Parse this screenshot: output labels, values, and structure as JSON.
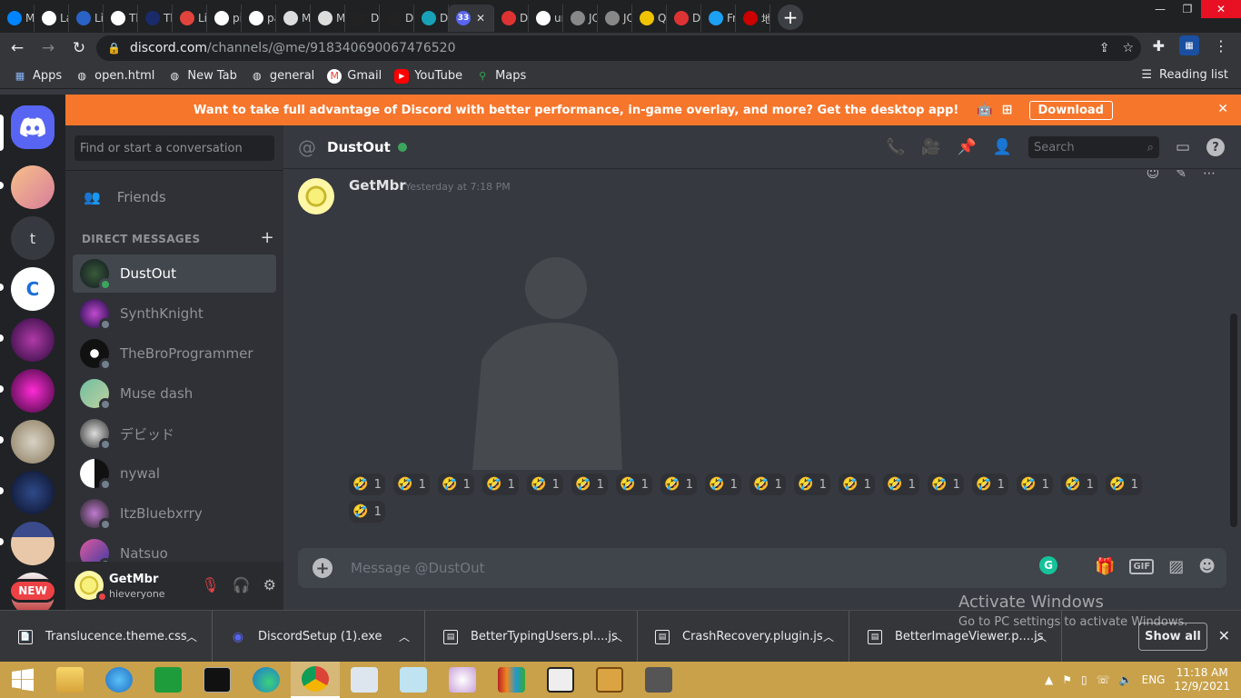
{
  "browser": {
    "tabs": [
      {
        "label": "Me",
        "color": "#0084ff"
      },
      {
        "label": "La",
        "color": "#ffffff"
      },
      {
        "label": "Lig",
        "color": "#2a62c6"
      },
      {
        "label": "Th",
        "color": "#ffffff"
      },
      {
        "label": "Th",
        "color": "#1a2b6b"
      },
      {
        "label": "Lig",
        "color": "#e0443c"
      },
      {
        "label": "pi",
        "color": "#ffffff"
      },
      {
        "label": "pa",
        "color": "#ffffff"
      },
      {
        "label": "M",
        "color": "#dddddd"
      },
      {
        "label": "M",
        "color": "#dddddd"
      },
      {
        "label": "DC",
        "color": "#222222"
      },
      {
        "label": "DC",
        "color": "#222222"
      },
      {
        "label": "Dc",
        "color": "#17a2b8"
      },
      {
        "label": "33",
        "color": "#5865f2",
        "active": true
      },
      {
        "label": "Di",
        "color": "#d33"
      },
      {
        "label": "un",
        "color": "#ffffff"
      },
      {
        "label": "JQ",
        "color": "#888888"
      },
      {
        "label": "JQ",
        "color": "#888888"
      },
      {
        "label": "Qu",
        "color": "#f0c300"
      },
      {
        "label": "Di",
        "color": "#d33"
      },
      {
        "label": "Fr",
        "color": "#1da1f2"
      },
      {
        "label": "地",
        "color": "#cc0000"
      }
    ],
    "url_host": "discord.com",
    "url_path": "/channels/@me/918340690067476520",
    "bookmarks": [
      {
        "label": "Apps",
        "icon": "apps-grid-icon"
      },
      {
        "label": "open.html",
        "icon": "globe-icon"
      },
      {
        "label": "New Tab",
        "icon": "globe-icon"
      },
      {
        "label": "general",
        "icon": "globe-icon"
      },
      {
        "label": "Gmail",
        "icon": "gmail-icon"
      },
      {
        "label": "YouTube",
        "icon": "youtube-icon"
      },
      {
        "label": "Maps",
        "icon": "maps-icon"
      }
    ],
    "reading_list": "Reading list"
  },
  "banner": {
    "text": "Want to take full advantage of Discord with better performance, in-game overlay, and more? Get the desktop app!",
    "download": "Download"
  },
  "guilds": {
    "new_badge": "NEW",
    "text_server": "t"
  },
  "dm": {
    "search_placeholder": "Find or start a conversation",
    "friends": "Friends",
    "header": "DIRECT MESSAGES",
    "items": [
      {
        "name": "DustOut",
        "active": true
      },
      {
        "name": "SynthKnight"
      },
      {
        "name": "TheBroProgrammer"
      },
      {
        "name": "Muse dash"
      },
      {
        "name": "デビッド"
      },
      {
        "name": "nywal"
      },
      {
        "name": "ItzBluebxrry"
      },
      {
        "name": "Natsuo"
      }
    ]
  },
  "user": {
    "name": "GetMbr",
    "status": "hieveryone"
  },
  "chat": {
    "channel_name": "DustOut",
    "search_placeholder": "Search",
    "message": {
      "author": "GetMbr",
      "timestamp": "Yesterday at 7:18 PM"
    },
    "reaction_emoji": "🤣",
    "reactions": [
      "1",
      "1",
      "1",
      "1",
      "1",
      "1",
      "1",
      "1",
      "1",
      "1",
      "1",
      "1",
      "1",
      "1",
      "1",
      "1",
      "1",
      "1",
      "1"
    ],
    "composer_placeholder": "Message @DustOut",
    "gif_label": "GIF"
  },
  "downloads": {
    "items": [
      "Translucence.theme.css",
      "DiscordSetup (1).exe",
      "BetterTypingUsers.pl....js",
      "CrashRecovery.plugin.js",
      "BetterImageViewer.p....js"
    ],
    "show_all": "Show all"
  },
  "watermark": {
    "title": "Activate Windows",
    "subtitle": "Go to PC settings to activate Windows."
  },
  "taskbar": {
    "time": "11:18 AM",
    "date": "12/9/2021",
    "lang": "ENG"
  },
  "colors": {
    "discord_blurple": "#5865f2",
    "banner_orange": "#f6762c",
    "online_green": "#3ba55d",
    "dnd_red": "#ed4245"
  }
}
